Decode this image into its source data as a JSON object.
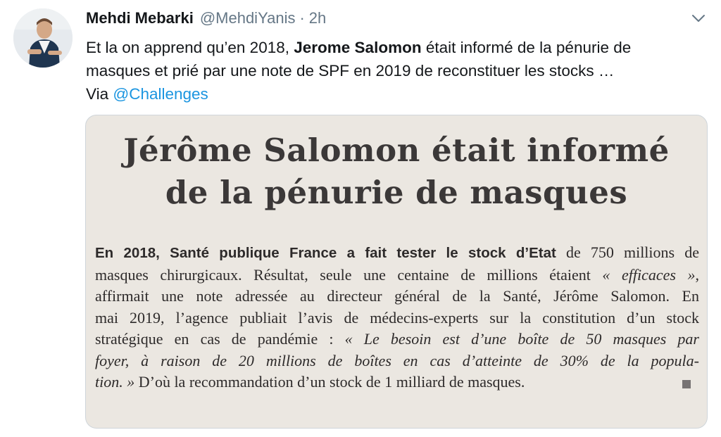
{
  "author": {
    "name": "Mehdi Mebarki",
    "handle": "@MehdiYanis",
    "separator": "·",
    "time": "2h"
  },
  "tweet": {
    "line1": {
      "pre": "Et la on apprend qu’en 2018, ",
      "bold": "Jerome Salomon",
      "post": " était informé de la pénurie de"
    },
    "line2": "masques et prié par une note de SPF  en 2019 de reconstituer les stocks …",
    "line3": {
      "pre": "Via ",
      "mention": "@Challenges"
    }
  },
  "article": {
    "headline": [
      "Jérôme Salomon était informé",
      "de la pénurie de masques"
    ],
    "lines": [
      {
        "lede": "En 2018, Santé publique France a fait tester le stock d’Etat",
        "rest": " de 750 millions de"
      },
      {
        "pre": "masques chirurgicaux. Résultat, seule une centaine de millions étaient ",
        "italic": "« efficaces »",
        "post": ","
      },
      {
        "text": "affirmait une note adressée au directeur général de la Santé, Jérôme Salomon. En"
      },
      {
        "text": "mai 2019, l’agence publiait l’avis de médecins-experts sur la constitution d’un stock"
      },
      {
        "pre": "stratégique en cas de pandémie : ",
        "italic": "« Le besoin est d’une boîte de 50 masques par"
      },
      {
        "italic": "foyer, à raison de 20 millions de boîtes en cas d’atteinte de 30% de la popula-"
      },
      {
        "italic": "tion. »",
        "post": " D’où la recommandation d’un stock de 1 milliard de masques."
      }
    ]
  },
  "icons": {
    "avatar": "profile-photo",
    "caret": "chevron-down-icon",
    "end_mark": "square-end-mark"
  },
  "colors": {
    "text": "#14171a",
    "secondary": "#657786",
    "link": "#1b95e0",
    "media_bg": "#ebe7e1"
  }
}
